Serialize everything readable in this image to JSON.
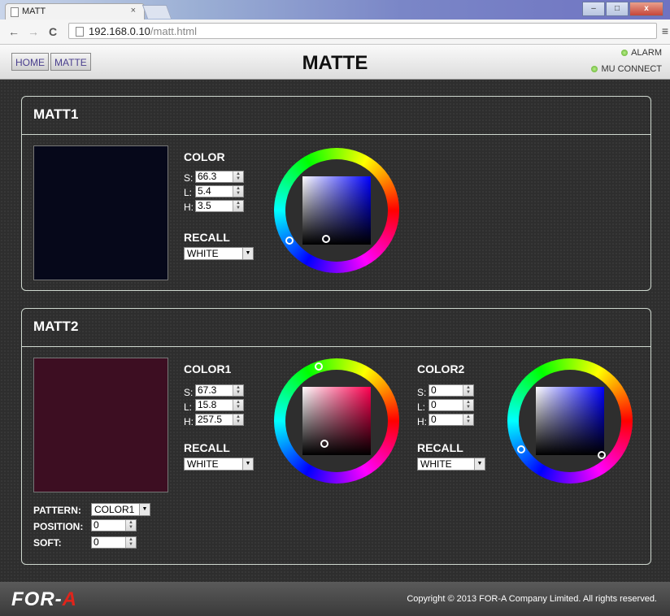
{
  "browser": {
    "tab_title": "MATT",
    "tab_close": "×",
    "url_host": "192.168.0.10",
    "url_path": "/matt.html",
    "back": "←",
    "forward": "→",
    "reload": "C",
    "menu": "≡",
    "minimize": "–",
    "maximize": "□",
    "close": "x"
  },
  "header": {
    "home_label": "HOME",
    "matte_label": "MATTE",
    "title": "MATTE",
    "alarm_label": "ALARM",
    "mu_connect_label": "MU CONNECT"
  },
  "matt1": {
    "title": "MATT1",
    "swatch_color": "#06081a",
    "color_label": "COLOR",
    "s_label": "S:",
    "s_value": "66.3",
    "l_label": "L:",
    "l_value": "5.4",
    "h_label": "H:",
    "h_value": "3.5",
    "recall_label": "RECALL",
    "recall_value": "WHITE"
  },
  "matt2": {
    "title": "MATT2",
    "swatch_color": "#3d0e22",
    "color1": {
      "label": "COLOR1",
      "s_label": "S:",
      "s_value": "67.3",
      "l_label": "L:",
      "l_value": "15.8",
      "h_label": "H:",
      "h_value": "257.5",
      "recall_label": "RECALL",
      "recall_value": "WHITE"
    },
    "color2": {
      "label": "COLOR2",
      "s_label": "S:",
      "s_value": "0",
      "l_label": "L:",
      "l_value": "0",
      "h_label": "H:",
      "h_value": "0",
      "recall_label": "RECALL",
      "recall_value": "WHITE"
    },
    "pattern_label": "PATTERN:",
    "pattern_value": "COLOR1",
    "position_label": "POSITION:",
    "position_value": "0",
    "soft_label": "SOFT:",
    "soft_value": "0"
  },
  "footer": {
    "logo_text": "FOR-",
    "logo_accent": "A",
    "copyright": "Copyright © 2013 FOR-A Company Limited. All rights reserved."
  },
  "colors": {
    "status_led": "#5aa826",
    "brand_red": "#e0241b"
  }
}
